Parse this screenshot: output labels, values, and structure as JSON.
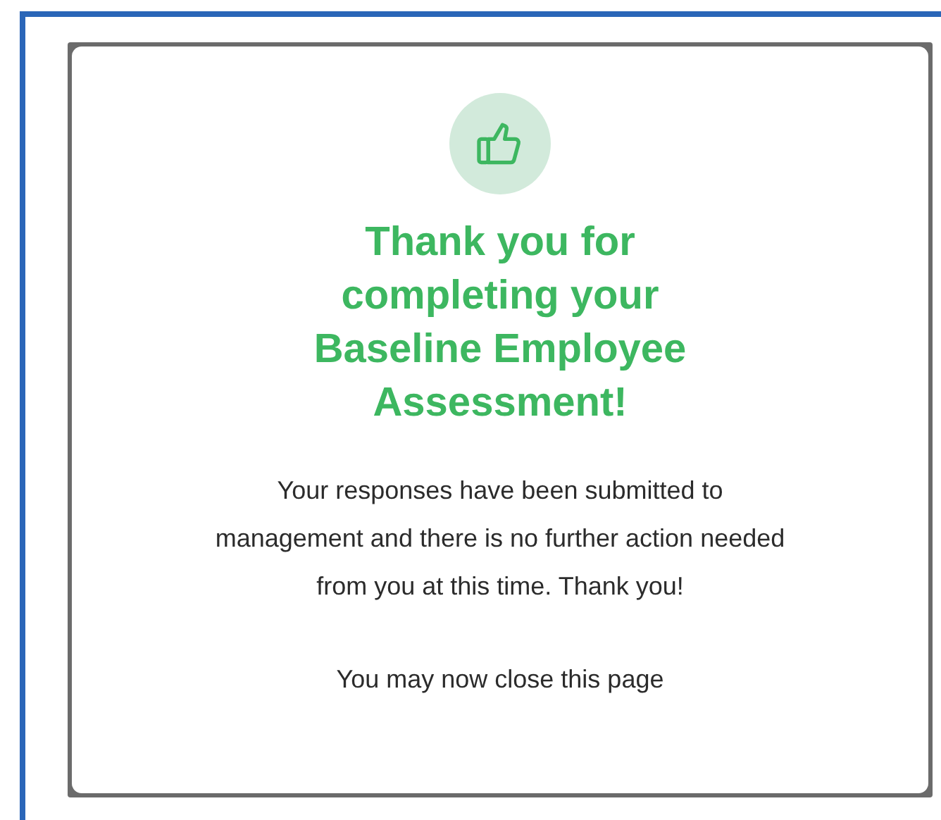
{
  "dialog": {
    "title": "Thank you for completing your Baseline Employee Assessment!",
    "message": "Your responses have been submitted to management and there is no further action needed from you at this time. Thank you!",
    "note": "You may now close this page"
  }
}
